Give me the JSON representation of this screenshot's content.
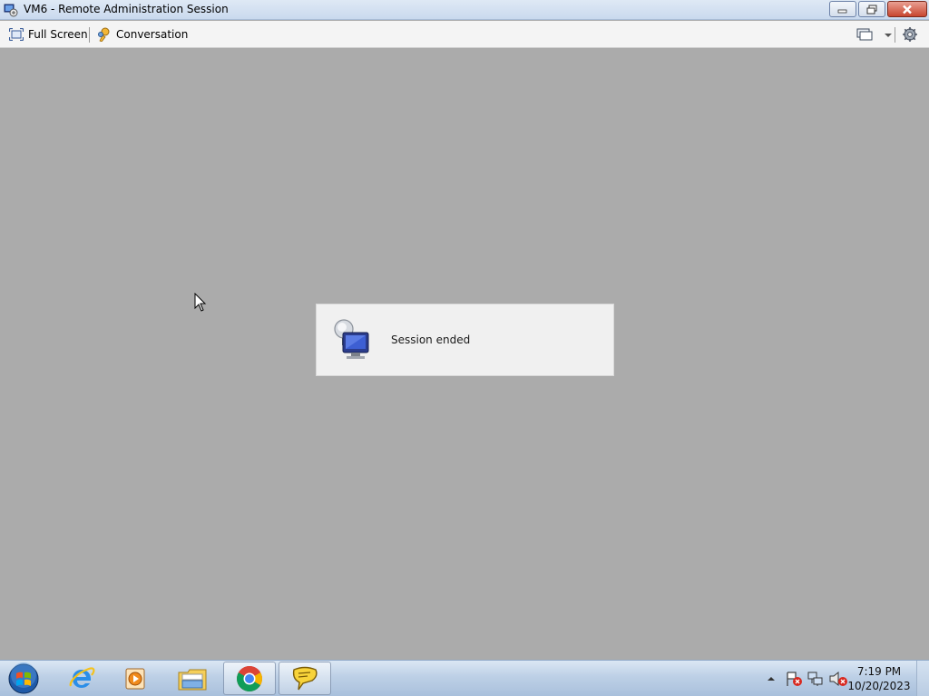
{
  "window": {
    "title": "VM6 - Remote Administration Session",
    "icon": "remote-admin-icon",
    "controls": [
      "minimize-icon",
      "restore-icon",
      "close-icon"
    ]
  },
  "toolbar": {
    "full_screen_label": "Full Screen",
    "conversation_label": "Conversation",
    "full_screen_icon": "fullscreen-icon",
    "conversation_icon": "conversation-icon",
    "right_icons": [
      "monitor-icon",
      "chevron-down-icon",
      "settings-icon"
    ]
  },
  "session": {
    "message": "Session ended",
    "icon": "disconnected-computer-icon"
  },
  "taskbar": {
    "apps": [
      {
        "name": "internet-explorer-icon",
        "active": false
      },
      {
        "name": "media-player-icon",
        "active": false
      },
      {
        "name": "file-explorer-icon",
        "active": false
      },
      {
        "name": "chrome-icon",
        "active": true
      },
      {
        "name": "chat-bubble-icon",
        "active": true
      }
    ],
    "tray_icons": [
      "show-hidden-icons-arrow",
      "action-center-flag-icon",
      "network-icon",
      "volume-muted-icon"
    ],
    "clock": {
      "time": "7:19 PM",
      "date": "10/20/2023"
    }
  },
  "colors": {
    "remote_background": "#ababab",
    "panel_background": "#f0f0f0",
    "titlebar": "#dfe9f5"
  }
}
